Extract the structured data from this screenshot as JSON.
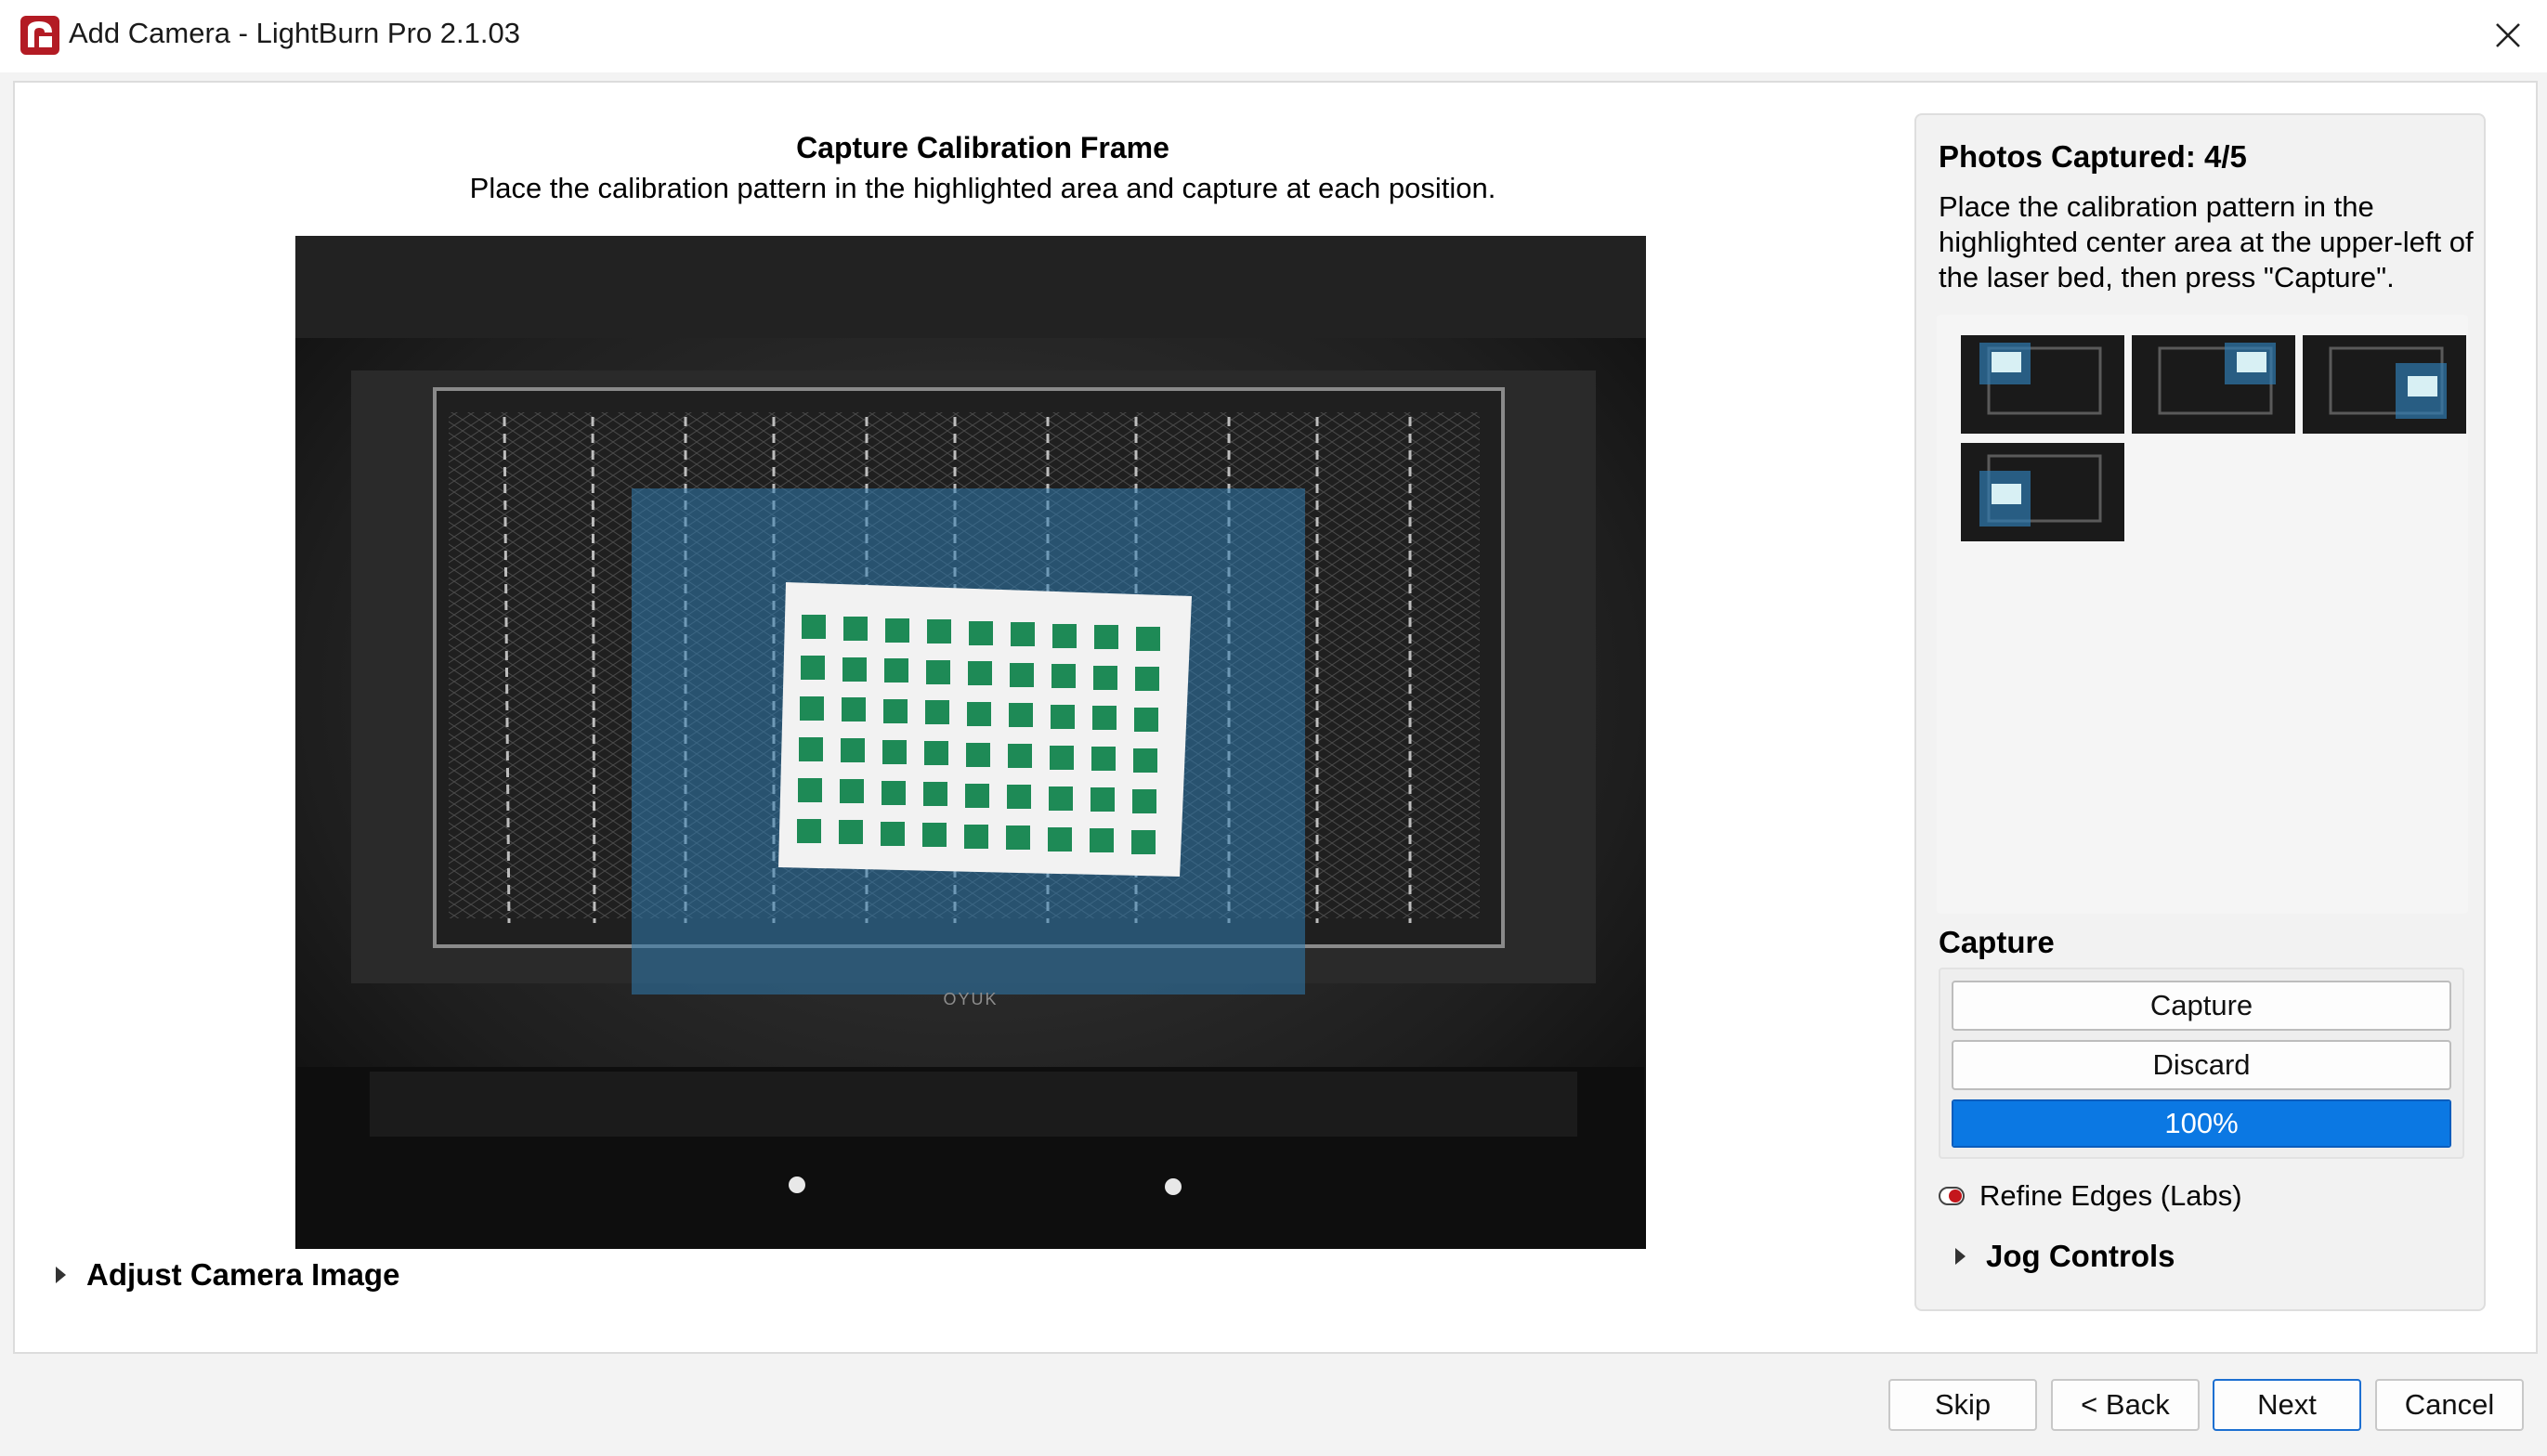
{
  "window": {
    "title": "Add Camera - LightBurn Pro 2.1.03",
    "app_icon": "lightburn-logo-icon",
    "close_icon": "close-icon"
  },
  "header": {
    "title": "Capture Calibration Frame",
    "instruction": "Place the calibration pattern in the highlighted area and capture at each position."
  },
  "camera_view": {
    "image": "laser-bed-camera-feed",
    "bed_brand": "OYUK"
  },
  "adjust_section": {
    "label": "Adjust Camera Image",
    "icon": "chevron-right-icon",
    "expanded": false
  },
  "side_panel": {
    "photos_title": "Photos Captured: 4/5",
    "instructions": "Place the calibration pattern in the highlighted center area at the upper-left of the laser bed, then press \"Capture\".",
    "thumbnails": [
      {
        "name": "capture-1",
        "target": "upper-left"
      },
      {
        "name": "capture-2",
        "target": "upper-right"
      },
      {
        "name": "capture-3",
        "target": "center-right"
      },
      {
        "name": "capture-4",
        "target": "center-left"
      }
    ],
    "capture_heading": "Capture",
    "capture_button": "Capture",
    "discard_button": "Discard",
    "progress": {
      "value": 1.0,
      "label": "100%"
    },
    "refine_edges": {
      "label": "Refine Edges (Labs)",
      "enabled": false
    },
    "jog_controls": {
      "label": "Jog Controls",
      "expanded": false
    }
  },
  "footer": {
    "skip": "Skip",
    "back": "< Back",
    "next": "Next",
    "cancel": "Cancel"
  },
  "colors": {
    "accent": "#0b78e3",
    "highlight": "#1f6a9a",
    "toggle_red": "#c4161c"
  }
}
